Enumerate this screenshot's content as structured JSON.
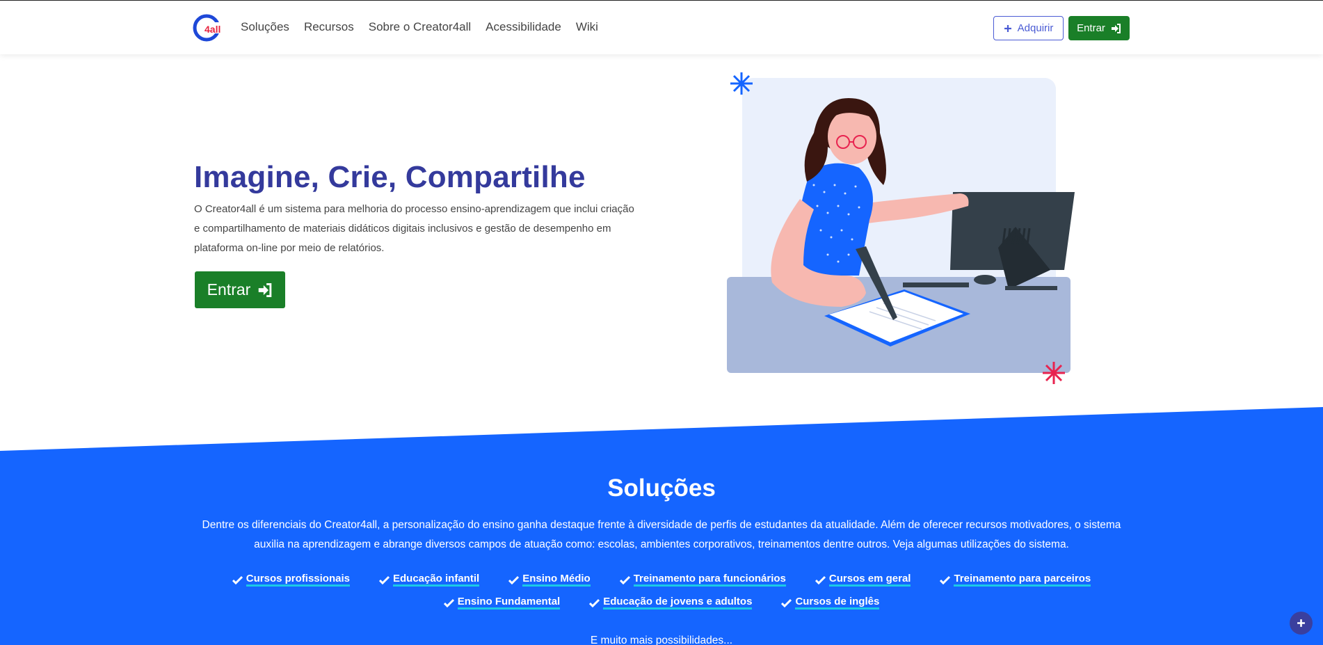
{
  "brand": {
    "logo_text": "4all",
    "logo_color": "#1e48d8",
    "logo_accent": "#e8233f"
  },
  "nav": {
    "links": [
      "Soluções",
      "Recursos",
      "Sobre o Creator4all",
      "Acessibilidade",
      "Wiki"
    ],
    "adquirir_label": "Adquirir",
    "entrar_label": "Entrar"
  },
  "hero": {
    "title": "Imagine, Crie, Compartilhe",
    "description": "O Creator4all é um sistema para melhoria do processo ensino-aprendizagem que inclui criação e compartilhamento de materiais didáticos digitais inclusivos e gestão de desempenho em plataforma on-line por meio de relatórios.",
    "cta_label": "Entrar"
  },
  "solucoes": {
    "title": "Soluções",
    "description": "Dentre os diferenciais do Creator4all, a personalização do ensino ganha destaque frente à diversidade de perfis de estudantes da atualidade. Além de oferecer recursos motivadores, o sistema auxilia na aprendizagem e abrange diversos campos de atuação como: escolas, ambientes corporativos, treinamentos dentre outros. Veja algumas utilizações do sistema.",
    "tags": [
      "Cursos profissionais",
      "Educação infantil",
      "Ensino Médio",
      "Treinamento para funcionários",
      "Cursos em geral",
      "Treinamento para parceiros",
      "Ensino Fundamental",
      "Educação de jovens e adultos",
      "Cursos de inglês"
    ],
    "more": "E muito mais possibilidades..."
  },
  "colors": {
    "primary_blue": "#1565ff",
    "title_indigo": "#343a9c",
    "cta_green": "#1a7f28",
    "underline_cyan": "#1bc9e6",
    "fab": "#3a3f9e"
  }
}
